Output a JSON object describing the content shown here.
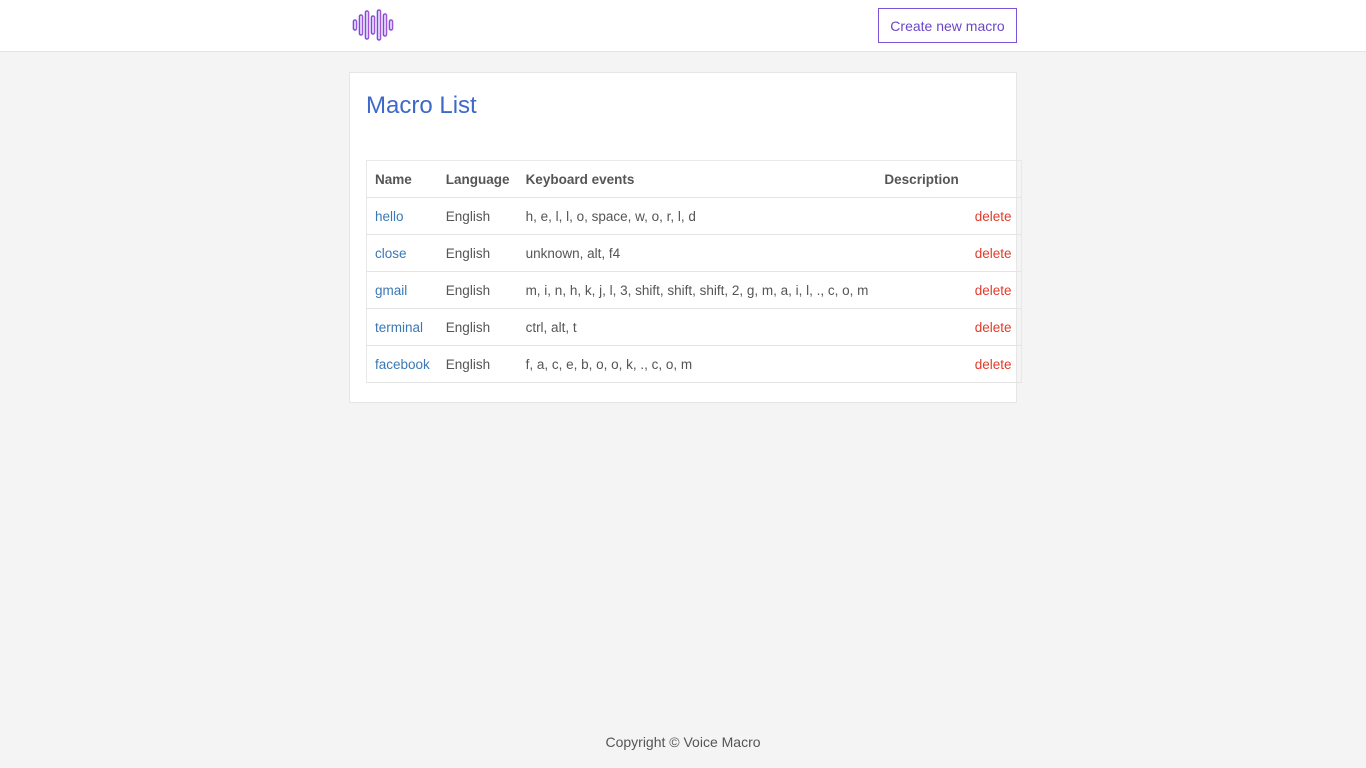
{
  "header": {
    "logo_icon": "sound-wave-icon",
    "create_button_label": "Create new macro"
  },
  "main": {
    "title": "Macro List",
    "columns": {
      "name": "Name",
      "language": "Language",
      "keyboard_events": "Keyboard events",
      "description": "Description"
    },
    "rows": [
      {
        "name": "hello",
        "language": "English",
        "keyboard_events": "h, e, l, l, o, space, w, o, r, l, d",
        "description": "",
        "action": "delete"
      },
      {
        "name": "close",
        "language": "English",
        "keyboard_events": "unknown, alt, f4",
        "description": "",
        "action": "delete"
      },
      {
        "name": "gmail",
        "language": "English",
        "keyboard_events": "m, i, n, h, k, j, l, 3, shift, shift, shift, 2, g, m, a, i, l, ., c, o, m",
        "description": "",
        "action": "delete"
      },
      {
        "name": "terminal",
        "language": "English",
        "keyboard_events": "ctrl, alt, t",
        "description": "",
        "action": "delete"
      },
      {
        "name": "facebook",
        "language": "English",
        "keyboard_events": "f, a, c, e, b, o, o, k, ., c, o, m",
        "description": "",
        "action": "delete"
      }
    ]
  },
  "footer": {
    "copyright": "Copyright © Voice Macro"
  },
  "colors": {
    "accent_purple": "#7b53d8",
    "link_blue": "#3a78b5",
    "title_blue": "#3f68c8",
    "delete_red": "#e23b2a",
    "background": "#f4f4f4"
  }
}
